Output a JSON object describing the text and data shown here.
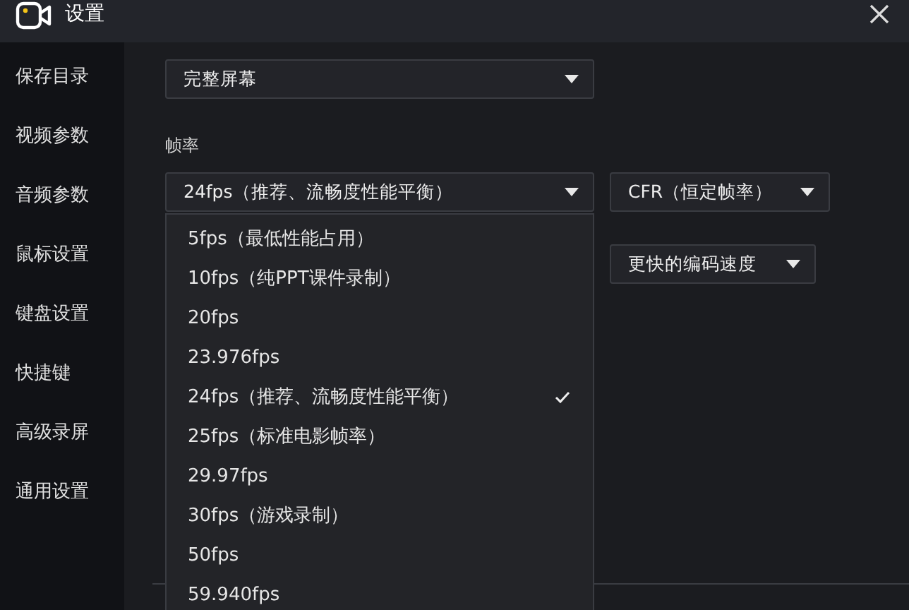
{
  "window": {
    "title": "设置"
  },
  "sidebar": {
    "items": [
      {
        "label": "保存目录",
        "selected": false
      },
      {
        "label": "视频参数",
        "selected": false
      },
      {
        "label": "音频参数",
        "selected": false
      },
      {
        "label": "鼠标设置",
        "selected": false
      },
      {
        "label": "键盘设置",
        "selected": false
      },
      {
        "label": "快捷键",
        "selected": false
      },
      {
        "label": "高级录屏",
        "selected": false
      },
      {
        "label": "通用设置",
        "selected": false
      }
    ]
  },
  "record_area": {
    "value": "完整屏幕"
  },
  "frame_rate": {
    "label": "帧率",
    "value": "24fps（推荐、流畅度性能平衡）",
    "mode": "CFR（恒定帧率）",
    "options": [
      {
        "label": "5fps（最低性能占用）",
        "selected": false
      },
      {
        "label": "10fps（纯PPT课件录制）",
        "selected": false
      },
      {
        "label": "20fps",
        "selected": false
      },
      {
        "label": "23.976fps",
        "selected": false
      },
      {
        "label": "24fps（推荐、流畅度性能平衡）",
        "selected": true
      },
      {
        "label": "25fps（标准电影帧率）",
        "selected": false
      },
      {
        "label": "29.97fps",
        "selected": false
      },
      {
        "label": "30fps（游戏录制）",
        "selected": false
      },
      {
        "label": "50fps",
        "selected": false
      },
      {
        "label": "59.940fps",
        "selected": false
      }
    ]
  },
  "encoder": {
    "value": "更快的编码速度"
  }
}
